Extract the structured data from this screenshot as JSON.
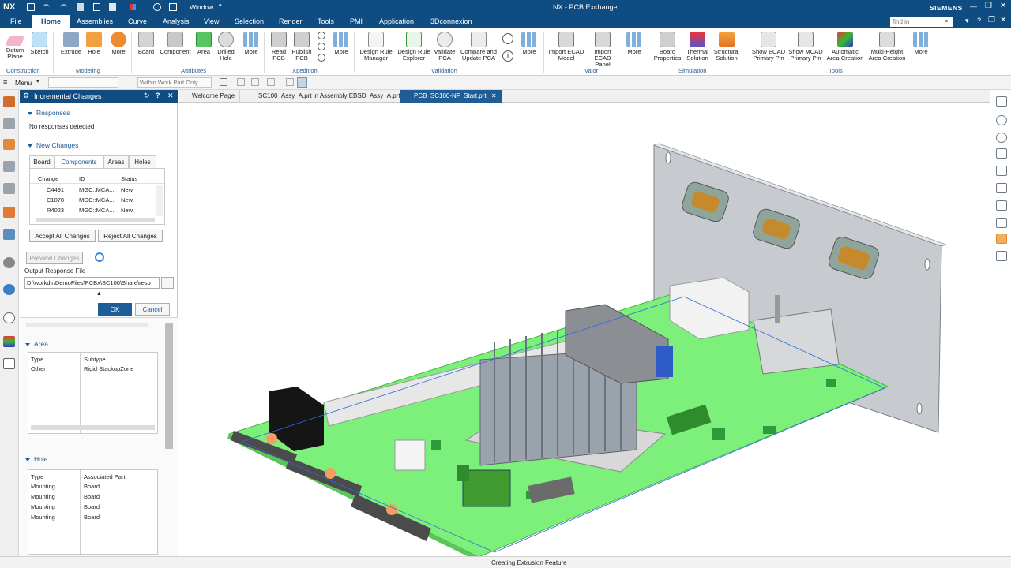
{
  "app": {
    "logo": "NX",
    "window_menu": "Window",
    "title": "NX - PCB Exchange",
    "brand": "SIEMENS",
    "search_placeholder": "find in"
  },
  "menu": [
    "File",
    "Home",
    "Assemblies",
    "Curve",
    "Analysis",
    "View",
    "Selection",
    "Render",
    "Tools",
    "PMI",
    "Application",
    "3Dconnexion"
  ],
  "ribbon": {
    "tools": [
      "Datum Plane",
      "Sketch",
      "Extrude",
      "Hole",
      "More",
      "Board",
      "Component",
      "Area",
      "Drilled Hole",
      "More",
      "Read PCB",
      "Publish PCB",
      "More",
      "Design Rule Manager",
      "Design Rule Explorer",
      "Validate PCA",
      "Compare and Update PCA",
      "More",
      "Import ECAD Model",
      "Import ECAD Panel",
      "More",
      "Board Properties",
      "Thermal Solution",
      "Structural Solution",
      "Show ECAD Primary Pin",
      "Show MCAD Primary Pin",
      "Automatic Area Creation",
      "Multi-Height Area Creation",
      "More"
    ],
    "groups": [
      "Construction",
      "Modeling",
      "Attributes",
      "Xpedition",
      "Validation",
      "Valor",
      "Simulation",
      "Tools"
    ]
  },
  "toolbar2": {
    "menu_label": "Menu",
    "filter_placeholder": "Within Work Part Only"
  },
  "panel": {
    "title": "Incremental Changes",
    "responses": {
      "header": "Responses",
      "text": "No responses detected"
    },
    "new_changes": {
      "header": "New Changes",
      "tabs": [
        "Board",
        "Components",
        "Areas",
        "Holes"
      ],
      "columns": [
        "Change",
        "ID",
        "Status"
      ],
      "rows": [
        {
          "change": "C4491",
          "id": "MGC::MCA...",
          "status": "New"
        },
        {
          "change": "C1078",
          "id": "MGC::MCA...",
          "status": "New"
        },
        {
          "change": "R4023",
          "id": "MGC::MCA...",
          "status": "New"
        }
      ],
      "accept_label": "Accept All Changes",
      "reject_label": "Reject All Changes"
    },
    "preview_label": "Preview Changes",
    "output_label": "Output Response File",
    "output_value": "D:\\workdir\\DemoFiles\\PCBx\\SC100\\Share\\resp",
    "ok_label": "OK",
    "cancel_label": "Cancel",
    "area": {
      "header": "Area",
      "columns": [
        "Type",
        "Subtype"
      ],
      "rows": [
        {
          "type": "Other",
          "subtype": "Rigid StackupZone"
        }
      ]
    },
    "hole": {
      "header": "Hole",
      "columns": [
        "Type",
        "Associated Part"
      ],
      "rows": [
        {
          "type": "Mounting",
          "part": "Board"
        },
        {
          "type": "Mounting",
          "part": "Board"
        },
        {
          "type": "Mounting",
          "part": "Board"
        },
        {
          "type": "Mounting",
          "part": "Board"
        }
      ]
    }
  },
  "doc_tabs": [
    "Welcome Page",
    "SC100_Assy_A.prt in Assembly EBSD_Assy_A.prt",
    "PCB_SC100-NF_Start.prt"
  ],
  "status": "Creating Extrusion Feature",
  "colors": {
    "accent": "#0f4c81",
    "board": "#7cf07a",
    "heatsink": "#9aa3ab",
    "panel": "#c9cdd2"
  }
}
